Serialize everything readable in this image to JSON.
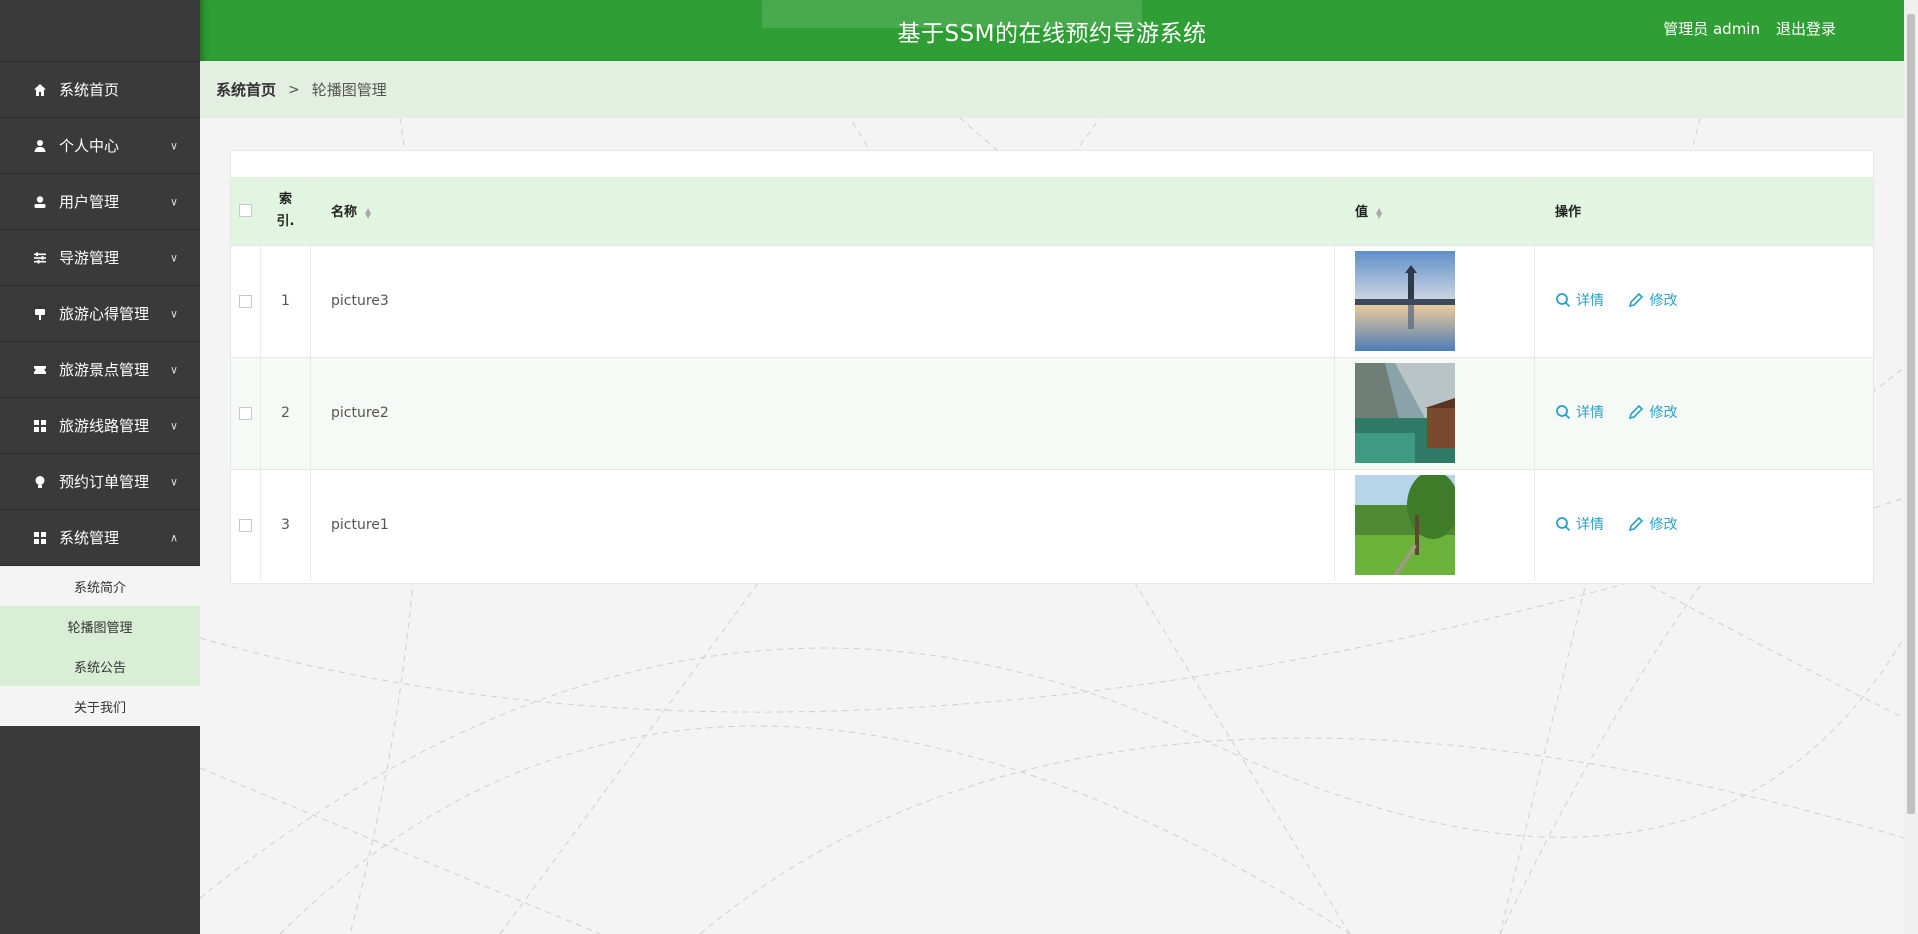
{
  "header": {
    "title": "基于SSM的在线预约导游系统",
    "user": "管理员 admin",
    "logout": "退出登录"
  },
  "sidebar": {
    "items": [
      {
        "label": "系统首页",
        "icon": "home-icon",
        "expandable": false
      },
      {
        "label": "个人中心",
        "icon": "person-icon",
        "expandable": true
      },
      {
        "label": "用户管理",
        "icon": "user-icon",
        "expandable": true
      },
      {
        "label": "导游管理",
        "icon": "sliders-icon",
        "expandable": true
      },
      {
        "label": "旅游心得管理",
        "icon": "signpost-icon",
        "expandable": true
      },
      {
        "label": "旅游景点管理",
        "icon": "ticket-icon",
        "expandable": true
      },
      {
        "label": "旅游线路管理",
        "icon": "grid-icon",
        "expandable": true
      },
      {
        "label": "预约订单管理",
        "icon": "bulb-icon",
        "expandable": true
      },
      {
        "label": "系统管理",
        "icon": "grid-icon",
        "expandable": true,
        "expanded": true
      }
    ],
    "submenu": [
      {
        "label": "系统简介"
      },
      {
        "label": "轮播图管理"
      },
      {
        "label": "系统公告"
      },
      {
        "label": "关于我们"
      }
    ]
  },
  "breadcrumb": {
    "home": "系统首页",
    "separator": ">",
    "current": "轮播图管理"
  },
  "table": {
    "headers": {
      "index": "索引.",
      "name": "名称",
      "value": "值",
      "actions": "操作"
    },
    "rows": [
      {
        "index": "1",
        "name": "picture3",
        "image": "pagoda-lake"
      },
      {
        "index": "2",
        "name": "picture2",
        "image": "mountain-lake-cabin"
      },
      {
        "index": "3",
        "name": "picture1",
        "image": "green-lawn-tree"
      }
    ],
    "detail_label": "详情",
    "edit_label": "修改"
  },
  "colors": {
    "brand_green": "#2f9e35",
    "sidebar_bg": "#3a3a3a",
    "header_row_bg": "#e1f5e0",
    "link": "#2aa0c6"
  }
}
